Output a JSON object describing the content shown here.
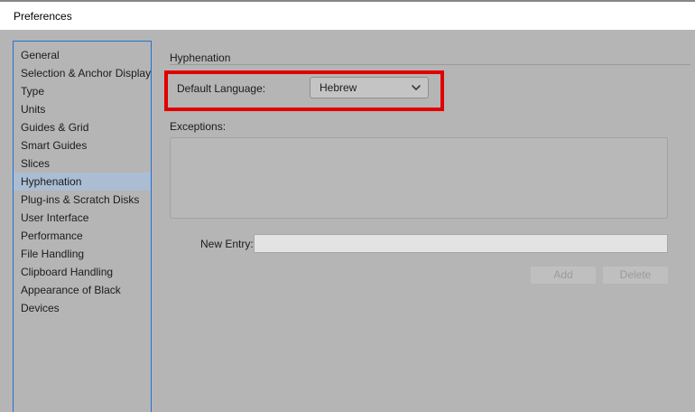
{
  "window": {
    "title": "Preferences"
  },
  "sidebar": {
    "items": [
      {
        "label": "General",
        "selected": false
      },
      {
        "label": "Selection & Anchor Display",
        "selected": false
      },
      {
        "label": "Type",
        "selected": false
      },
      {
        "label": "Units",
        "selected": false
      },
      {
        "label": "Guides & Grid",
        "selected": false
      },
      {
        "label": "Smart Guides",
        "selected": false
      },
      {
        "label": "Slices",
        "selected": false
      },
      {
        "label": "Hyphenation",
        "selected": true
      },
      {
        "label": "Plug-ins & Scratch Disks",
        "selected": false
      },
      {
        "label": "User Interface",
        "selected": false
      },
      {
        "label": "Performance",
        "selected": false
      },
      {
        "label": "File Handling",
        "selected": false
      },
      {
        "label": "Clipboard Handling",
        "selected": false
      },
      {
        "label": "Appearance of Black",
        "selected": false
      },
      {
        "label": "Devices",
        "selected": false
      }
    ]
  },
  "panel": {
    "title": "Hyphenation",
    "default_language": {
      "label": "Default Language:",
      "value": "Hebrew"
    },
    "exceptions": {
      "label": "Exceptions:",
      "items": []
    },
    "new_entry": {
      "label": "New Entry:",
      "value": "",
      "placeholder": ""
    },
    "buttons": {
      "add": "Add",
      "delete": "Delete"
    }
  },
  "annotation": {
    "type": "highlight-rectangle",
    "color": "#e00000"
  },
  "colors": {
    "dialog_background": "#b5b5b5",
    "titlebar_background": "#ffffff",
    "sidebar_border": "#2271d4",
    "selected_item_background": "#abbdd3",
    "annotation_red": "#e00000",
    "input_background": "#e3e3e3",
    "disabled_button_text": "#9b9b9b"
  }
}
